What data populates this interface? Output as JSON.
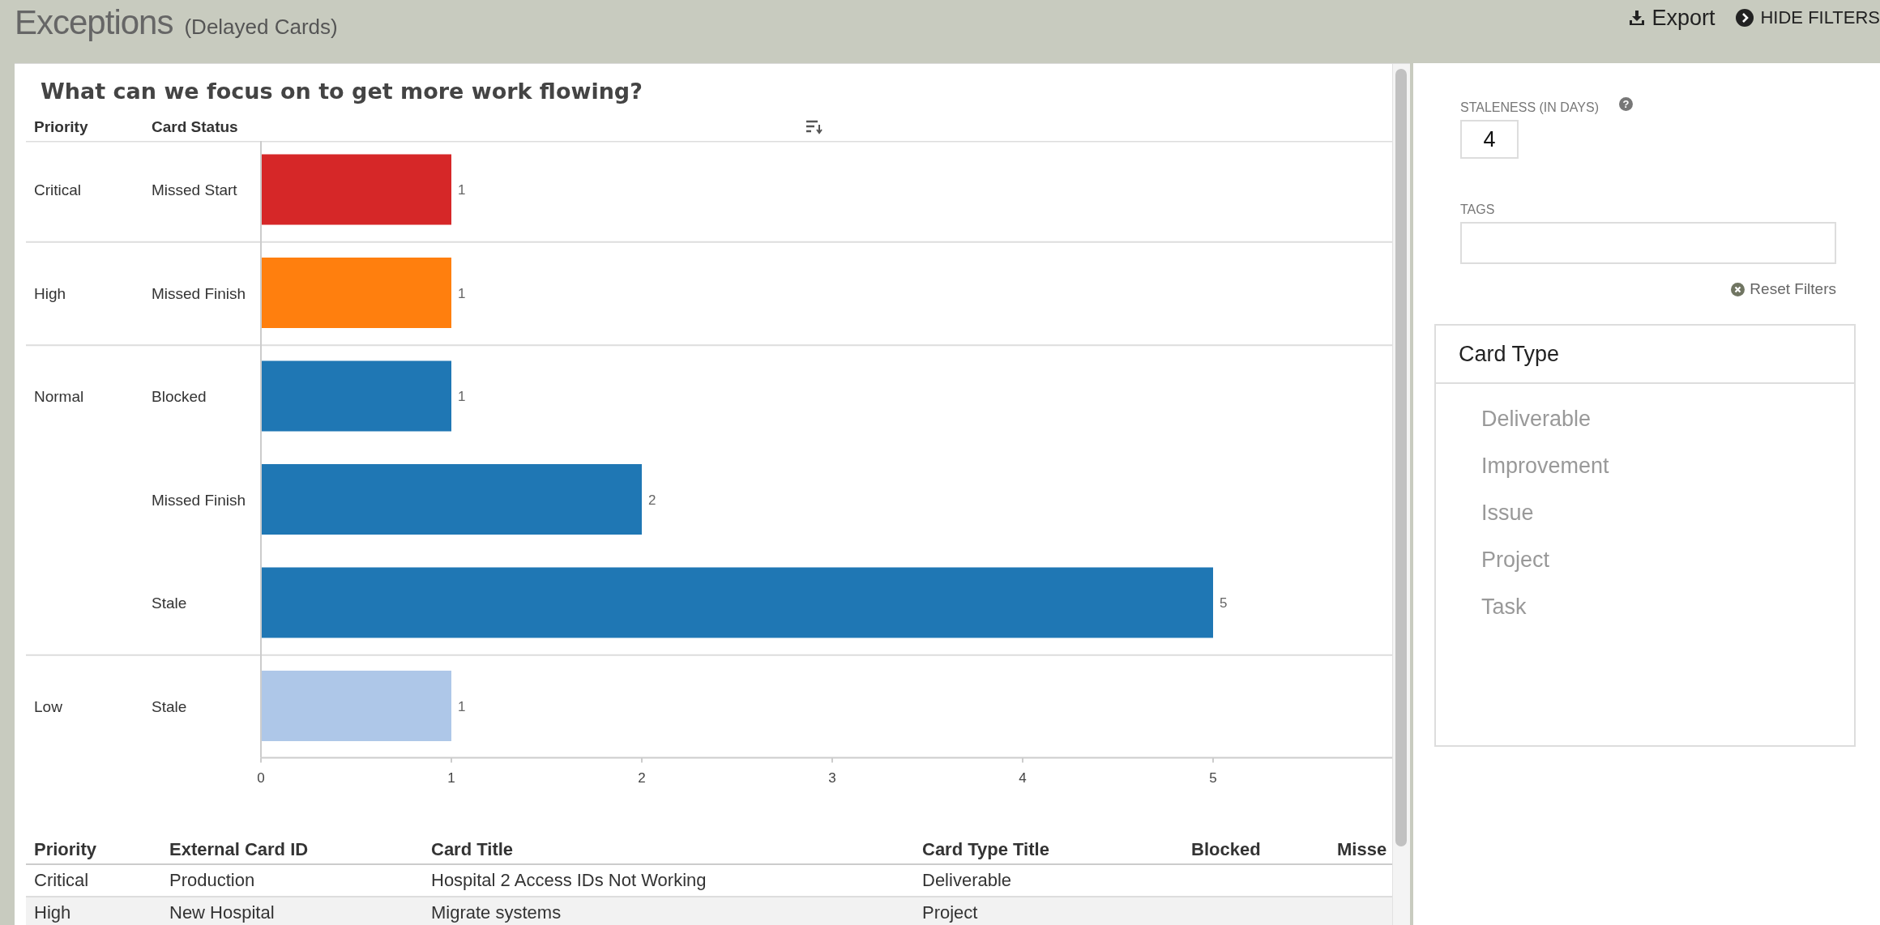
{
  "page": {
    "title": "Exceptions",
    "subtitle": "(Delayed Cards)",
    "actions": [
      {
        "label": "Export",
        "kind": "export"
      },
      {
        "label": "HIDE FILTERS",
        "kind": "toggle"
      }
    ]
  },
  "chart_panel": {
    "title": "What can we focus on to get more work flowing?",
    "row_headers": [
      "Priority",
      "Card Status"
    ],
    "priority_groups": [
      "Critical",
      "High",
      "Normal",
      "Low"
    ],
    "chart_data": {
      "type": "bar",
      "orientation": "horizontal",
      "categories": [
        "Missed Start",
        "Missed Finish",
        "Blocked",
        "Missed Finish",
        "Stale",
        "Stale"
      ],
      "series": [
        {
          "color": "#d62728",
          "values": [
            1,
            null,
            null,
            null,
            null,
            null
          ]
        },
        {
          "color": "#ff7f0e",
          "values": [
            null,
            1,
            null,
            null,
            null,
            null
          ]
        },
        {
          "color": "#1f77b4",
          "values": [
            null,
            null,
            1,
            2,
            5,
            null
          ]
        },
        {
          "color": "#aec7e8",
          "values": [
            null,
            null,
            null,
            null,
            null,
            1
          ]
        }
      ],
      "xlim": [
        0,
        6
      ],
      "xticks": [
        0,
        1,
        2,
        3,
        4,
        5
      ],
      "data_labels": true
    }
  },
  "table": {
    "columns": [
      "Priority",
      "External Card ID",
      "Card Title",
      "Card Type Title",
      "Blocked",
      "Misse"
    ],
    "rows": [
      {
        "cells": [
          "Critical",
          "Production",
          "Hospital 2 Access IDs Not Working",
          "Deliverable"
        ]
      },
      {
        "cells": [
          "High",
          "New Hospital",
          "Migrate systems",
          "Project"
        ]
      }
    ]
  },
  "filters": {
    "staleness": {
      "label": "STALENESS (IN DAYS)",
      "help": "?",
      "value": "4"
    },
    "tags": {
      "label": "TAGS"
    },
    "reset": "Reset Filters",
    "card_type": {
      "title": "Card Type",
      "items": [
        "Deliverable",
        "Improvement",
        "Issue",
        "Project",
        "Task"
      ]
    }
  }
}
